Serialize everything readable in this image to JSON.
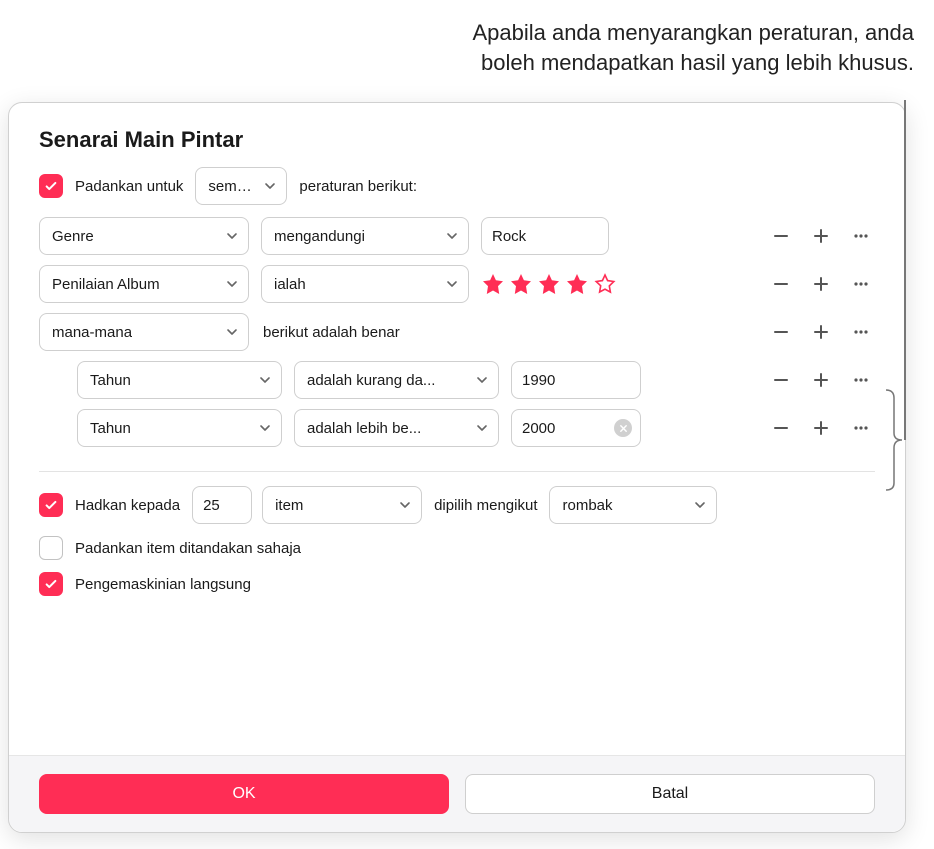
{
  "caption_line1": "Apabila anda menyarangkan peraturan, anda",
  "caption_line2": "boleh mendapatkan hasil yang lebih khusus.",
  "dialog": {
    "title": "Senarai Main Pintar",
    "match": {
      "checked": true,
      "label_before": "Padankan untuk",
      "mode": "semua",
      "label_after": "peraturan berikut:"
    },
    "rules": [
      {
        "field": "Genre",
        "op": "mengandungi",
        "value": "Rock",
        "type": "text"
      },
      {
        "field": "Penilaian Album",
        "op": "ialah",
        "type": "stars",
        "stars_filled": 4,
        "stars_total": 5
      },
      {
        "type": "group",
        "group_mode": "mana-mana",
        "group_suffix": "berikut adalah benar",
        "children": [
          {
            "field": "Tahun",
            "op": "adalah kurang da...",
            "value": "1990",
            "type": "text"
          },
          {
            "field": "Tahun",
            "op": "adalah lebih be...",
            "value": "2000",
            "type": "text",
            "has_clear": true
          }
        ]
      }
    ],
    "limit": {
      "checked": true,
      "label_before": "Hadkan kepada",
      "value": "25",
      "unit": "item",
      "label_mid": "dipilih mengikut",
      "by": "rombak"
    },
    "only_checked": {
      "checked": false,
      "label": "Padankan item ditandakan sahaja"
    },
    "live_update": {
      "checked": true,
      "label": "Pengemaskinian langsung"
    },
    "buttons": {
      "ok": "OK",
      "cancel": "Batal"
    }
  }
}
